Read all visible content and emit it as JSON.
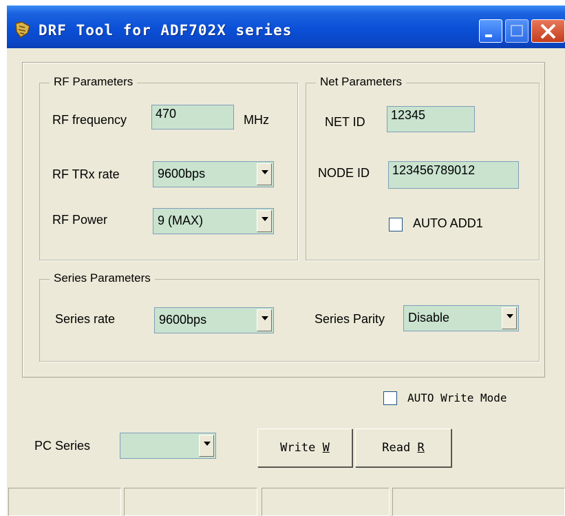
{
  "window": {
    "title": "DRF Tool for ADF702X series"
  },
  "rf_group": {
    "title": "RF Parameters",
    "frequency_label": "RF frequency",
    "frequency_value": "470",
    "frequency_unit": "MHz",
    "trx_rate_label": "RF TRx rate",
    "trx_rate_value": "9600bps",
    "power_label": "RF Power",
    "power_value": "9 (MAX)"
  },
  "net_group": {
    "title": "Net Parameters",
    "net_id_label": "NET ID",
    "net_id_value": "12345",
    "node_id_label": "NODE ID",
    "node_id_value": "123456789012",
    "auto_add_label": "AUTO ADD1",
    "auto_add_checked": false
  },
  "series_group": {
    "title": "Series Parameters",
    "rate_label": "Series rate",
    "rate_value": "9600bps",
    "parity_label": "Series Parity",
    "parity_value": "Disable"
  },
  "auto_write": {
    "label": "AUTO Write Mode",
    "checked": false
  },
  "pc_series": {
    "label": "PC Series",
    "value": ""
  },
  "buttons": {
    "write_label": "Write ",
    "write_key": "W",
    "read_label": "Read ",
    "read_key": "R"
  },
  "status_bar": {
    "panels": [
      "",
      "",
      "",
      ""
    ]
  },
  "colors": {
    "field_bg": "#c9e3cf",
    "window_bg": "#ece9d8",
    "titlebar": "#0a4fd6"
  }
}
